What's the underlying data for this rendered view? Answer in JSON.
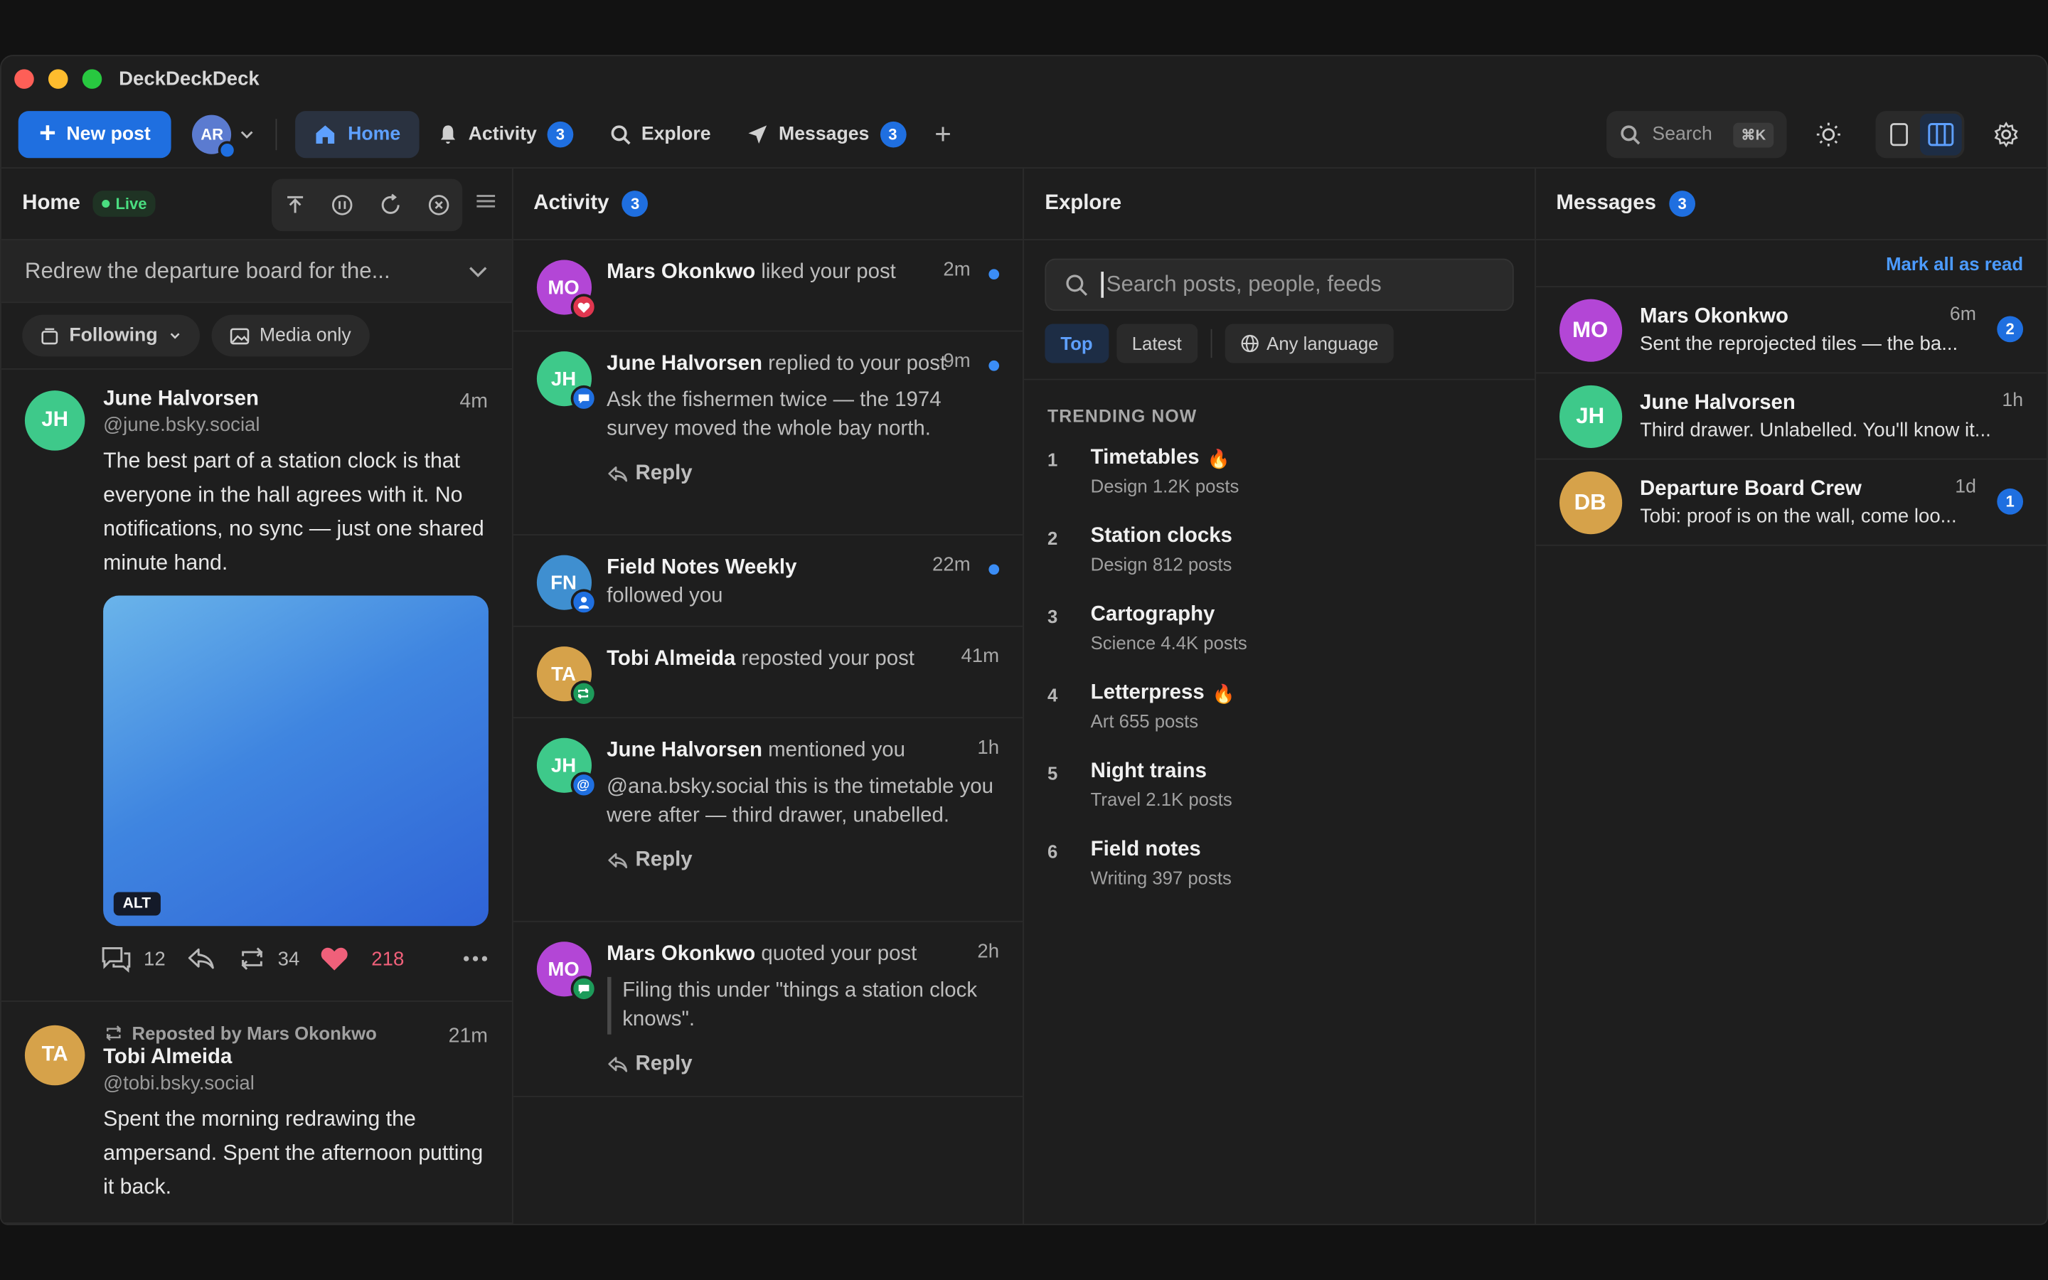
{
  "app": {
    "title": "DeckDeckDeck"
  },
  "toolbar": {
    "new_post": "New post",
    "account_initials": "AR",
    "tabs": [
      {
        "label": "Home"
      },
      {
        "label": "Activity",
        "badge": "3"
      },
      {
        "label": "Explore"
      },
      {
        "label": "Messages",
        "badge": "3"
      }
    ],
    "search_label": "Search",
    "search_shortcut": "⌘K"
  },
  "home": {
    "title": "Home",
    "live": "Live",
    "feed_selector": "Redrew the departure board for the...",
    "filters": [
      "Following",
      "Media only"
    ],
    "posts": [
      {
        "initials": "JH",
        "name": "June Halvorsen",
        "handle": "@june.bsky.social",
        "time": "4m",
        "text": "The best part of a station clock is that everyone in the hall agrees with it. No notifications, no sync — just one shared minute hand.",
        "alt": "ALT",
        "replies": "12",
        "reposts": "34",
        "likes": "218"
      },
      {
        "repost_by": "Reposted by Mars Okonkwo",
        "initials": "TA",
        "name": "Tobi Almeida",
        "handle": "@tobi.bsky.social",
        "time": "21m",
        "text": "Spent the morning redrawing the ampersand. Spent the afternoon putting it back."
      }
    ]
  },
  "activity": {
    "title": "Activity",
    "badge": "3",
    "reply_label": "Reply",
    "items": [
      {
        "initials": "MO",
        "name": "Mars Okonkwo",
        "action": "liked your post",
        "time": "2m"
      },
      {
        "initials": "JH",
        "name": "June Halvorsen",
        "action": "replied to your post",
        "time": "9m",
        "quote": "Ask the fishermen twice — the 1974 survey moved the whole bay north."
      },
      {
        "initials": "FN",
        "name": "Field Notes Weekly",
        "action": "followed you",
        "time": "22m"
      },
      {
        "initials": "TA",
        "name": "Tobi Almeida",
        "action": "reposted your post",
        "time": "41m"
      },
      {
        "initials": "JH",
        "name": "June Halvorsen",
        "action": "mentioned you",
        "time": "1h",
        "quote": "@ana.bsky.social this is the timetable you were after — third drawer, unabelled."
      },
      {
        "initials": "MO",
        "name": "Mars Okonkwo",
        "action": "quoted your post",
        "time": "2h",
        "quote": "Filing this under \"things a station clock knows\"."
      }
    ]
  },
  "explore": {
    "title": "Explore",
    "search_placeholder": "Search posts, people, feeds",
    "tabs": [
      "Top",
      "Latest",
      "Any language"
    ],
    "trending_title": "TRENDING NOW",
    "trends": [
      {
        "rank": "1",
        "name": "Timetables",
        "meta": "Design 1.2K posts"
      },
      {
        "rank": "2",
        "name": "Station clocks",
        "meta": "Design 812 posts"
      },
      {
        "rank": "3",
        "name": "Cartography",
        "meta": "Science 4.4K posts"
      },
      {
        "rank": "4",
        "name": "Letterpress",
        "meta": "Art 655 posts"
      },
      {
        "rank": "5",
        "name": "Night trains",
        "meta": "Travel 2.1K posts"
      },
      {
        "rank": "6",
        "name": "Field notes",
        "meta": "Writing 397 posts"
      }
    ]
  },
  "messages": {
    "title": "Messages",
    "badge": "3",
    "mark_all": "Mark all as read",
    "threads": [
      {
        "initials": "MO",
        "name": "Mars Okonkwo",
        "preview": "Sent the reprojected tiles — the ba...",
        "time": "6m",
        "unread": "2"
      },
      {
        "initials": "JH",
        "name": "June Halvorsen",
        "preview": "Third drawer. Unlabelled. You'll know it...",
        "time": "1h"
      },
      {
        "initials": "DB",
        "name": "Departure Board Crew",
        "preview": "Tobi: proof is on the wall, come loo...",
        "time": "1d",
        "unread": "1"
      }
    ]
  },
  "colors": {
    "accent": "#1f6fe0",
    "live": "#4ade80",
    "like": "#f0607a",
    "mo": "#b346d6",
    "jh": "#3ec98a",
    "fn": "#3f8fd0",
    "ta": "#d6a24a"
  }
}
